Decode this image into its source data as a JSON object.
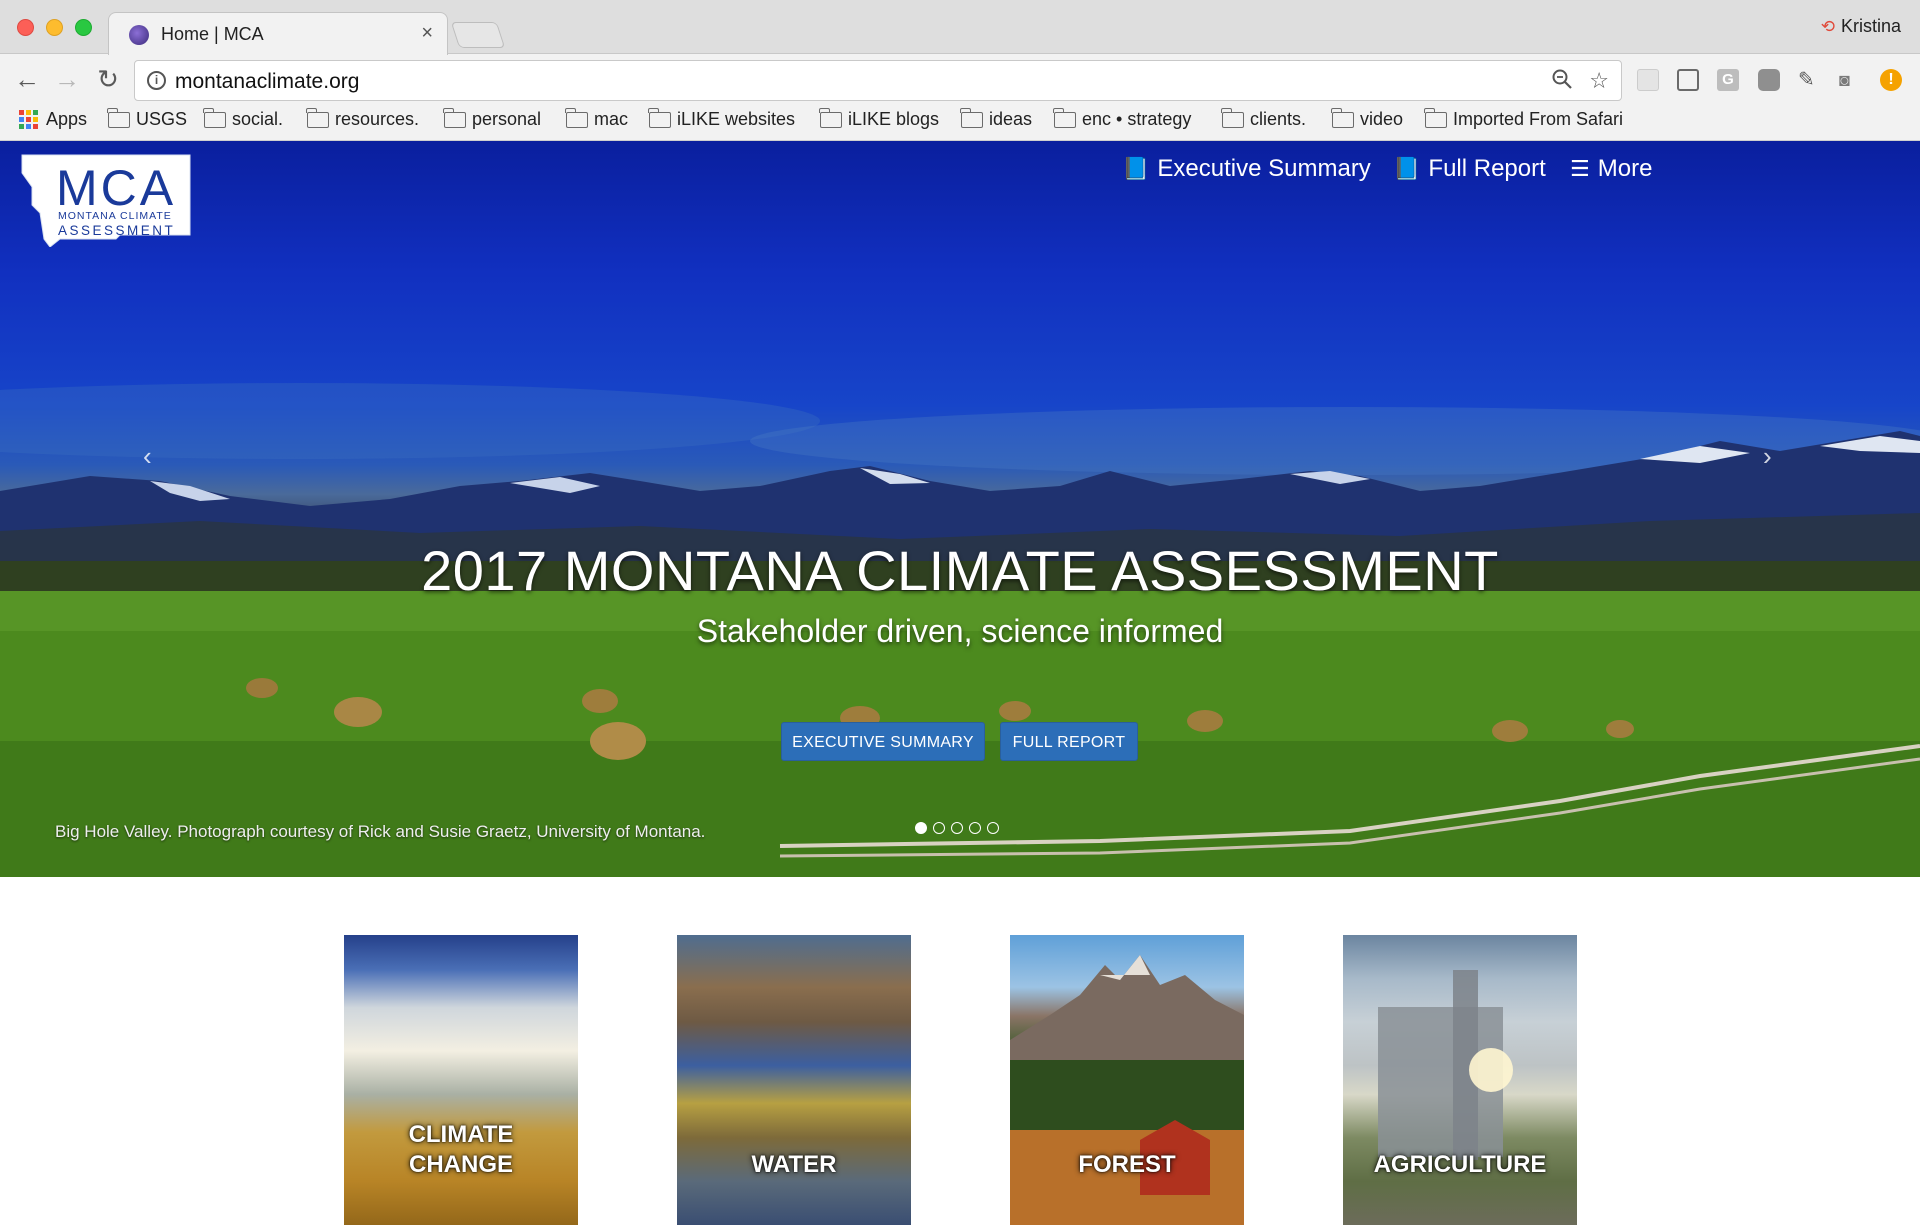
{
  "browser": {
    "tab_title": "Home | MCA",
    "tab_close": "×",
    "profile_name": "Kristina",
    "url": "montanaclimate.org",
    "bookmarks": [
      {
        "label": "Apps",
        "icon": "apps-grid-icon"
      },
      {
        "label": "USGS",
        "icon": "folder-icon"
      },
      {
        "label": "social.",
        "icon": "folder-icon"
      },
      {
        "label": "resources.",
        "icon": "folder-icon"
      },
      {
        "label": "personal",
        "icon": "folder-icon"
      },
      {
        "label": "mac",
        "icon": "folder-icon"
      },
      {
        "label": "iLIKE websites",
        "icon": "folder-icon"
      },
      {
        "label": "iLIKE blogs",
        "icon": "folder-icon"
      },
      {
        "label": "ideas",
        "icon": "folder-icon"
      },
      {
        "label": "enc • strategy",
        "icon": "folder-icon"
      },
      {
        "label": "clients.",
        "icon": "folder-icon"
      },
      {
        "label": "video",
        "icon": "folder-icon"
      },
      {
        "label": "Imported From Safari",
        "icon": "folder-icon"
      }
    ]
  },
  "site": {
    "logo": {
      "big": "MCA",
      "line1": "MONTANA CLIMATE",
      "line2": "ASSESSMENT"
    },
    "nav": [
      {
        "label": "Executive Summary",
        "icon": "book-icon"
      },
      {
        "label": "Full Report",
        "icon": "book-icon"
      },
      {
        "label": "More",
        "icon": "hamburger-icon"
      }
    ],
    "hero": {
      "title": "2017 MONTANA CLIMATE ASSESSMENT",
      "subtitle": "Stakeholder driven, science informed",
      "button_exec": "EXECUTIVE SUMMARY",
      "button_full": "FULL REPORT",
      "caption": "Big Hole Valley. Photograph courtesy of Rick and Susie Graetz, University of Montana.",
      "slides_total": 5,
      "active_slide": 1,
      "prev_arrow": "‹",
      "next_arrow": "›"
    },
    "tiles": [
      {
        "line1": "CLIMATE",
        "line2": "CHANGE"
      },
      {
        "line1": "WATER"
      },
      {
        "line1": "FOREST"
      },
      {
        "line1": "AGRICULTURE"
      }
    ]
  }
}
